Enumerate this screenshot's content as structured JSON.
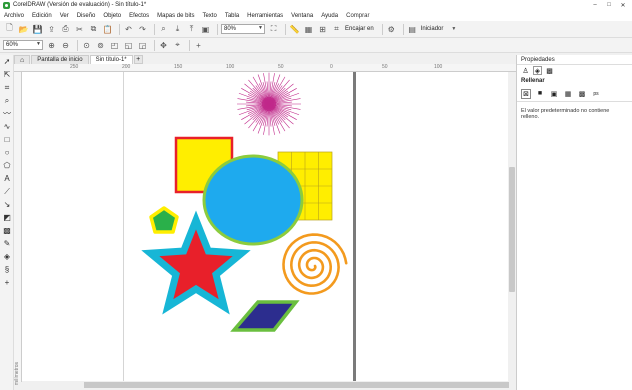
{
  "window": {
    "title": "CorelDRAW (Versión de evaluación) - Sin título-1*",
    "minimize": "–",
    "maximize": "□",
    "close": "✕"
  },
  "menu": [
    "Archivo",
    "Edición",
    "Ver",
    "Diseño",
    "Objeto",
    "Efectos",
    "Mapas de bits",
    "Texto",
    "Tabla",
    "Herramientas",
    "Ventana",
    "Ayuda",
    "Comprar"
  ],
  "toolbar1": {
    "zoom_value": "80%",
    "snap_label": "Encajar en",
    "launch_label": "Iniciador"
  },
  "toolbar2": {
    "zoom_value": "60%"
  },
  "tabs": [
    {
      "label": "Pantalla de inicio",
      "icon": "home-icon"
    },
    {
      "label": "Sin título-1*"
    }
  ],
  "tab_add": "+",
  "ruler": {
    "label": "milímetros",
    "marks": [
      "250",
      "200",
      "150",
      "100",
      "50",
      "0",
      "50",
      "100",
      "150",
      "200"
    ]
  },
  "docker": {
    "title": "Propiedades",
    "section": "Rellenar",
    "message": "El valor predeterminado no contiene relleno."
  },
  "colors": {
    "accent": "#2d9b3a",
    "square_fill": "#ffee00",
    "square_stroke": "#e8202a",
    "ellipse_fill": "#1eaaee",
    "ellipse_stroke": "#8ccc3d",
    "grid_fill": "#ffee00",
    "star_fill": "#e8202a",
    "star_stroke": "#17b6d6",
    "pentagon_fill": "#2ab04a",
    "pentagon_stroke": "#ffee00",
    "spiral": "#f39a1e",
    "parallelogram_fill": "#2c2d8e",
    "parallelogram_stroke": "#6abf3f",
    "starburst": "#c0288a"
  }
}
